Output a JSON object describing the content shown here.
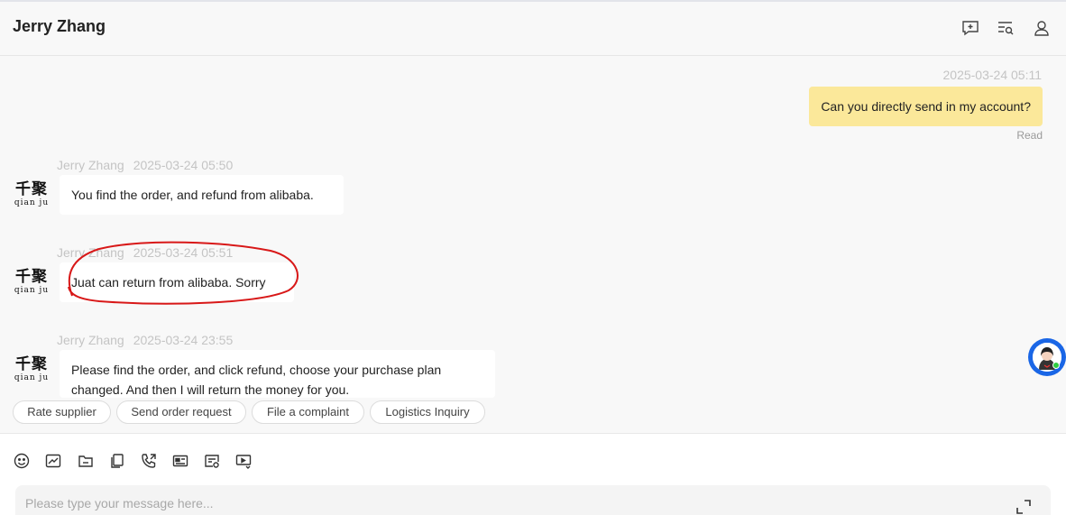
{
  "header": {
    "title": "Jerry Zhang",
    "icons": [
      "add-chat-icon",
      "search-history-icon",
      "user-profile-icon"
    ]
  },
  "messages": [
    {
      "direction": "outgoing",
      "time": "2025-03-24 05:11",
      "text": "Can you directly send in my account?",
      "status": "Read"
    },
    {
      "direction": "incoming",
      "sender": "Jerry Zhang",
      "time": "2025-03-24 05:50",
      "text": "You find the order, and refund from alibaba."
    },
    {
      "direction": "incoming",
      "sender": "Jerry Zhang",
      "time": "2025-03-24 05:51",
      "text": "Juat can return from alibaba. Sorry",
      "annotated": true
    },
    {
      "direction": "incoming",
      "sender": "Jerry Zhang",
      "time": "2025-03-24 23:55",
      "text": "Please find the order, and click refund, choose your purchase plan changed. And then I will return the money for you."
    }
  ],
  "avatar": {
    "logo_cn": "千聚",
    "logo_en": "qian ju"
  },
  "quick_replies": [
    "Rate supplier",
    "Send order request",
    "File a complaint",
    "Logistics Inquiry"
  ],
  "composer": {
    "placeholder": "Please type your message here...",
    "tools": [
      "emoji-icon",
      "chart-icon",
      "folder-icon",
      "copy-icon",
      "phone-icon",
      "card-icon",
      "order-icon",
      "video-icon"
    ]
  },
  "colors": {
    "outgoing_bubble": "#fbe89a",
    "incoming_bubble": "#ffffff",
    "annotation": "#d81818",
    "assistant": "#1a66e6",
    "online": "#2ecc40"
  }
}
